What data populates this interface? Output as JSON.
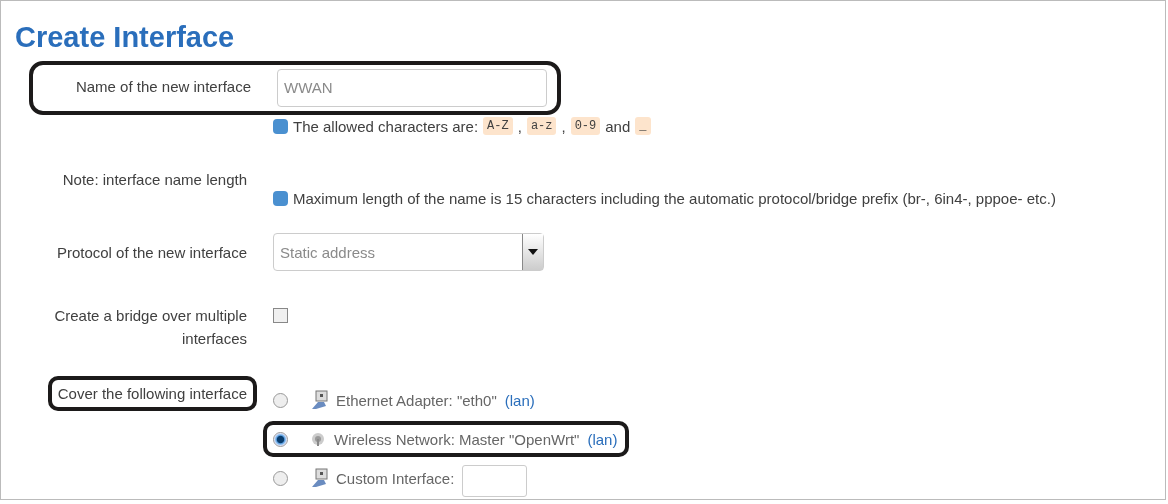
{
  "title": "Create Interface",
  "name_row": {
    "label": "Name of the new interface",
    "value": "WWAN",
    "highlighted": true,
    "hint_parts": [
      {
        "kind": "text",
        "text": "The allowed characters are:"
      },
      {
        "kind": "code",
        "text": "A-Z"
      },
      {
        "kind": "text",
        "text": ","
      },
      {
        "kind": "code",
        "text": "a-z"
      },
      {
        "kind": "text",
        "text": ","
      },
      {
        "kind": "code",
        "text": "0-9"
      },
      {
        "kind": "text",
        "text": "and"
      },
      {
        "kind": "code",
        "text": "_"
      }
    ]
  },
  "note_row": {
    "label": "Note: interface name length",
    "hint": "Maximum length of the name is 15 characters including the automatic protocol/bridge prefix (br-, 6in4-, pppoe- etc.)"
  },
  "protocol_row": {
    "label": "Protocol of the new interface",
    "value": "Static address"
  },
  "bridge_row": {
    "label": "Create a bridge over multiple interfaces",
    "checked": false
  },
  "cover_row": {
    "label": "Cover the following interface",
    "highlighted": true,
    "options": [
      {
        "kind": "ethernet",
        "text": "Ethernet Adapter: \"eth0\"",
        "link": "(lan)",
        "selected": false,
        "highlighted": false
      },
      {
        "kind": "wireless",
        "text": "Wireless Network: Master \"OpenWrt\"",
        "link": "(lan)",
        "selected": true,
        "highlighted": true
      },
      {
        "kind": "custom",
        "text": "Custom Interface:",
        "selected": false,
        "highlighted": false
      }
    ]
  }
}
